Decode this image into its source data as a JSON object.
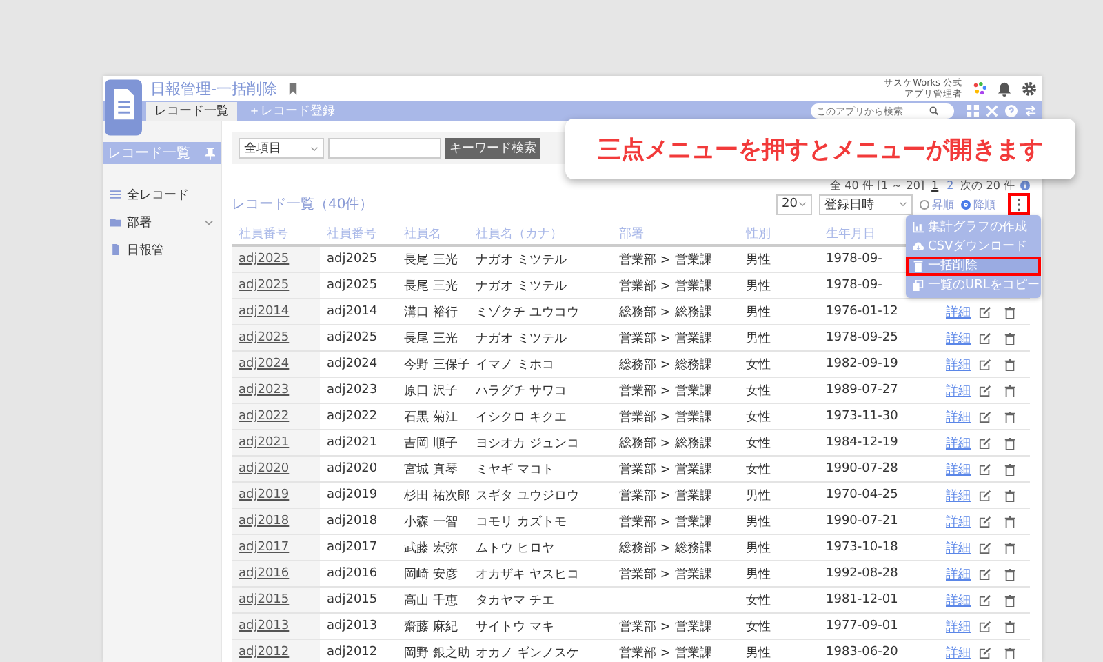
{
  "header": {
    "title": "日報管理-一括削除",
    "company": "サスケWorks 公式",
    "user": "アプリ管理者"
  },
  "tabs": [
    {
      "label": "レコード一覧",
      "selected": true
    },
    {
      "label": "＋レコード登録",
      "selected": false
    }
  ],
  "app_search": {
    "placeholder": "このアプリから検索"
  },
  "sidebar": {
    "title": "レコード一覧",
    "items": [
      {
        "label": "全レコード",
        "kind": "list",
        "expandable": false
      },
      {
        "label": "部署",
        "kind": "folder",
        "expandable": true
      },
      {
        "label": "日報管",
        "kind": "file",
        "expandable": false
      }
    ]
  },
  "keyword_search": {
    "field": "全項目",
    "button": "キーワード検索"
  },
  "list_title": "レコード一覧（40件）",
  "pagination": {
    "summary": "全 40 件 [1 ～ 20]",
    "pages": [
      {
        "label": "1",
        "selected": true
      },
      {
        "label": "2",
        "selected": false
      }
    ],
    "next": "次の 20 件"
  },
  "controls": {
    "per_page": "20",
    "sort_field": "登録日時",
    "order": [
      {
        "label": "昇順",
        "selected": false
      },
      {
        "label": "降順",
        "selected": true
      }
    ]
  },
  "callout": "三点メニューを押すとメニューが開きます",
  "menu": [
    {
      "label": "集計グラフの作成",
      "kind": "chart",
      "selected": false
    },
    {
      "label": "CSVダウンロード",
      "kind": "cloud",
      "selected": false
    },
    {
      "label": "一括削除",
      "kind": "trash",
      "selected": true
    },
    {
      "label": "一覧のURLをコピー",
      "kind": "copy",
      "selected": false
    }
  ],
  "table": {
    "columns": [
      "社員番号",
      "社員番号",
      "社員名",
      "社員名（カナ）",
      "部署",
      "性別",
      "生年月日"
    ],
    "rows": [
      {
        "link": "adj2025",
        "id": "adj2025",
        "name": "長尾 三光",
        "kana": "ナガオ ミツテル",
        "dept": "営業部 > 営業課",
        "gender": "男性",
        "birth": "1978-09-"
      },
      {
        "link": "adj2025",
        "id": "adj2025",
        "name": "長尾 三光",
        "kana": "ナガオ ミツテル",
        "dept": "営業部 > 営業課",
        "gender": "男性",
        "birth": "1978-09-"
      },
      {
        "link": "adj2014",
        "id": "adj2014",
        "name": "溝口 裕行",
        "kana": "ミゾクチ ユウコウ",
        "dept": "総務部 > 総務課",
        "gender": "男性",
        "birth": "1976-01-12",
        "detail": "詳細"
      },
      {
        "link": "adj2025",
        "id": "adj2025",
        "name": "長尾 三光",
        "kana": "ナガオ ミツテル",
        "dept": "営業部 > 営業課",
        "gender": "男性",
        "birth": "1978-09-25",
        "detail": "詳細"
      },
      {
        "link": "adj2024",
        "id": "adj2024",
        "name": "今野 三保子",
        "kana": "イマノ ミホコ",
        "dept": "総務部 > 総務課",
        "gender": "女性",
        "birth": "1982-09-19",
        "detail": "詳細"
      },
      {
        "link": "adj2023",
        "id": "adj2023",
        "name": "原口 沢子",
        "kana": "ハラグチ サワコ",
        "dept": "営業部 > 営業課",
        "gender": "女性",
        "birth": "1989-07-27",
        "detail": "詳細"
      },
      {
        "link": "adj2022",
        "id": "adj2022",
        "name": "石黒 菊江",
        "kana": "イシクロ キクエ",
        "dept": "営業部 > 営業課",
        "gender": "女性",
        "birth": "1973-11-30",
        "detail": "詳細"
      },
      {
        "link": "adj2021",
        "id": "adj2021",
        "name": "吉岡 順子",
        "kana": "ヨシオカ ジュンコ",
        "dept": "総務部 > 総務課",
        "gender": "女性",
        "birth": "1984-12-19",
        "detail": "詳細"
      },
      {
        "link": "adj2020",
        "id": "adj2020",
        "name": "宮城 真琴",
        "kana": "ミヤギ マコト",
        "dept": "営業部 > 営業課",
        "gender": "女性",
        "birth": "1990-07-28",
        "detail": "詳細"
      },
      {
        "link": "adj2019",
        "id": "adj2019",
        "name": "杉田 祐次郎",
        "kana": "スギタ ユウジロウ",
        "dept": "営業部 > 営業課",
        "gender": "男性",
        "birth": "1970-04-25",
        "detail": "詳細"
      },
      {
        "link": "adj2018",
        "id": "adj2018",
        "name": "小森 一智",
        "kana": "コモリ カズトモ",
        "dept": "営業部 > 営業課",
        "gender": "男性",
        "birth": "1990-07-21",
        "detail": "詳細"
      },
      {
        "link": "adj2017",
        "id": "adj2017",
        "name": "武藤 宏弥",
        "kana": "ムトウ ヒロヤ",
        "dept": "総務部 > 総務課",
        "gender": "男性",
        "birth": "1973-10-18",
        "detail": "詳細"
      },
      {
        "link": "adj2016",
        "id": "adj2016",
        "name": "岡崎 安彦",
        "kana": "オカザキ ヤスヒコ",
        "dept": "営業部 > 営業課",
        "gender": "男性",
        "birth": "1992-08-28",
        "detail": "詳細"
      },
      {
        "link": "adj2015",
        "id": "adj2015",
        "name": "高山 千恵",
        "kana": "タカヤマ チエ",
        "gender": "女性",
        "birth": "1981-12-01",
        "detail": "詳細"
      },
      {
        "link": "adj2013",
        "id": "adj2013",
        "name": "齋藤 麻紀",
        "kana": "サイトウ マキ",
        "dept": "営業部 > 営業課",
        "gender": "女性",
        "birth": "1977-09-01",
        "detail": "詳細"
      },
      {
        "link": "adj2012",
        "id": "adj2012",
        "name": "岡野 銀之助",
        "kana": "オカノ ギンノスケ",
        "dept": "営業部 > 営業課",
        "gender": "男性",
        "birth": "1983-06-20",
        "detail": "詳細"
      }
    ]
  }
}
